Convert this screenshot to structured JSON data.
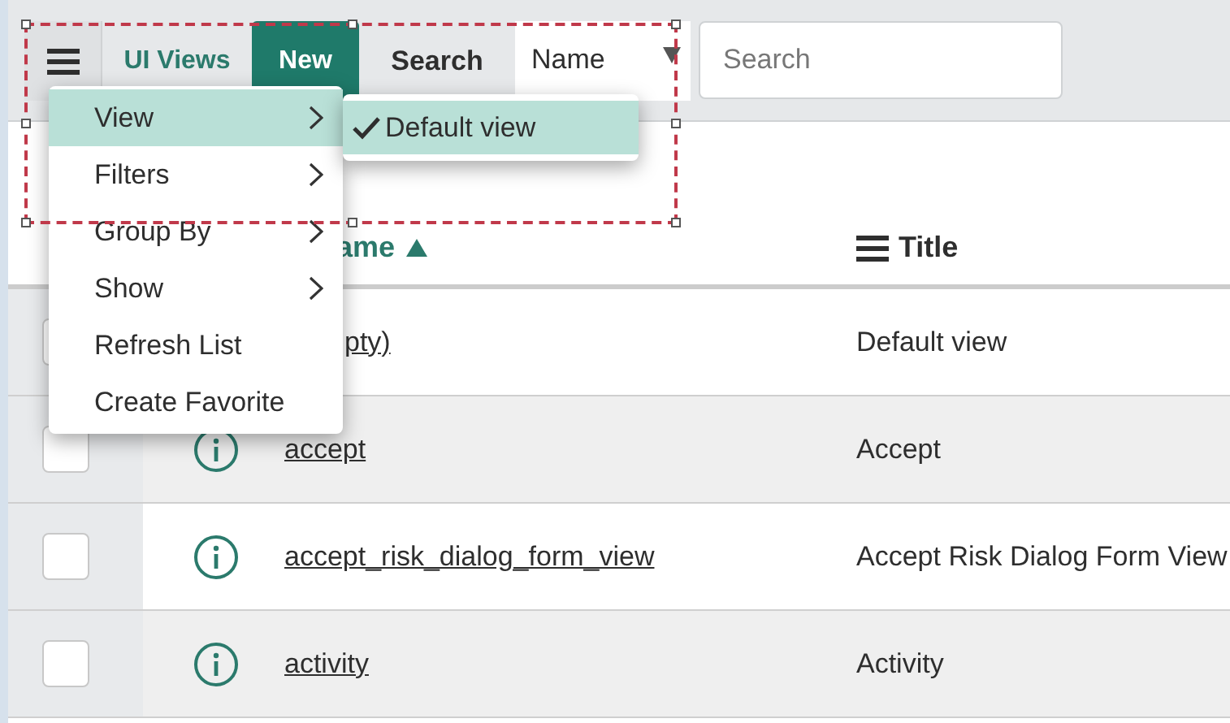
{
  "toolbar": {
    "title": "UI Views",
    "new_button": "New",
    "search_label": "Search",
    "search_select": "Name",
    "search_placeholder": "Search"
  },
  "context_menu": {
    "items": [
      {
        "label": "View",
        "kind": "submenu",
        "selected": true
      },
      {
        "label": "Filters",
        "kind": "submenu",
        "selected": false
      },
      {
        "label": "Group By",
        "kind": "submenu",
        "selected": false
      },
      {
        "label": "Show",
        "kind": "submenu",
        "selected": false
      },
      {
        "label": "Refresh List",
        "kind": "action",
        "selected": false
      },
      {
        "label": "Create Favorite",
        "kind": "action",
        "selected": false
      }
    ]
  },
  "submenu": {
    "items": [
      {
        "label": "Default view",
        "checked": true,
        "selected": true
      }
    ]
  },
  "table": {
    "columns": [
      {
        "label": "ame",
        "sorted": true
      },
      {
        "label": "Title",
        "sorted": false
      }
    ],
    "rows": [
      {
        "checked": false,
        "name": "pty)",
        "title": "Default view"
      },
      {
        "checked": false,
        "name": "accept",
        "title": "Accept"
      },
      {
        "checked": false,
        "name": "accept_risk_dialog_form_view",
        "title": "Accept Risk Dialog Form View"
      },
      {
        "checked": false,
        "name": "activity",
        "title": "Activity"
      }
    ]
  }
}
